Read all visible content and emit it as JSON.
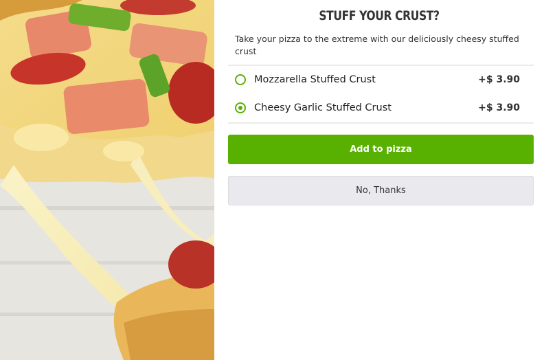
{
  "dialog": {
    "title": "STUFF YOUR CRUST?",
    "description": "Take your pizza to the extreme with our deliciously cheesy stuffed crust"
  },
  "options": [
    {
      "label": "Mozzarella Stuffed Crust",
      "price": "+$ 3.90",
      "selected": false
    },
    {
      "label": "Cheesy Garlic Stuffed Crust",
      "price": "+$ 3.90",
      "selected": true
    }
  ],
  "buttons": {
    "add_label": "Add to pizza",
    "decline_label": "No, Thanks"
  },
  "colors": {
    "accent": "#58b000",
    "secondary_button": "#eaeaee",
    "title_text": "#333333"
  },
  "image": {
    "subject": "pizza-cheese-pull-photo"
  }
}
